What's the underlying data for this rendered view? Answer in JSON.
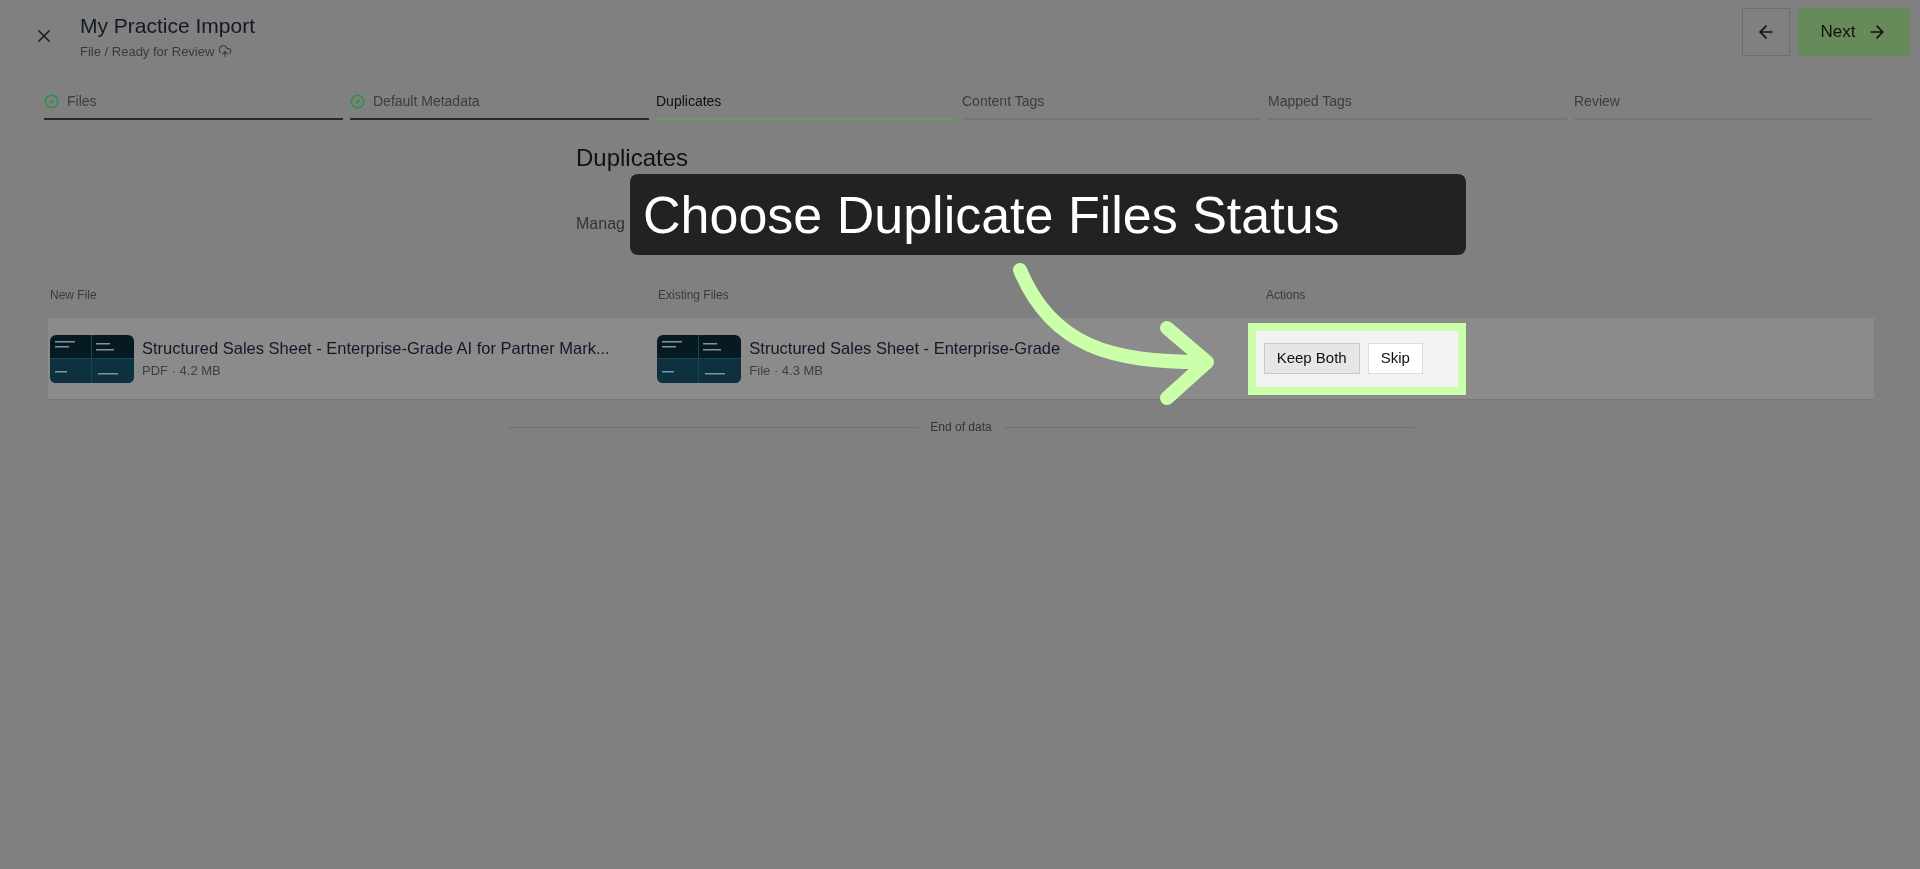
{
  "header": {
    "title": "My Practice Import",
    "breadcrumb": "File / Ready for Review",
    "next_label": "Next"
  },
  "steps": [
    {
      "label": "Files",
      "completed": true,
      "selected": false
    },
    {
      "label": "Default Metadata",
      "completed": true,
      "selected": false
    },
    {
      "label": "Duplicates",
      "completed": false,
      "selected": true
    },
    {
      "label": "Content Tags",
      "completed": false,
      "selected": false
    },
    {
      "label": "Mapped Tags",
      "completed": false,
      "selected": false
    },
    {
      "label": "Review",
      "completed": false,
      "selected": false
    }
  ],
  "section": {
    "title": "Duplicates",
    "subtitle": "Manag"
  },
  "table": {
    "columns": [
      "New File",
      "Existing Files",
      "Actions"
    ],
    "rows": [
      {
        "new_file": {
          "name": "Structured Sales Sheet - Enterprise-Grade AI for Partner Mark...",
          "meta": "PDF · 4.2 MB",
          "kind": "picture"
        },
        "existing_file": {
          "name": "Structured Sales Sheet - Enterprise-Grade",
          "meta": "File · 4.3 MB",
          "kind": "picture"
        },
        "actions": [
          {
            "label": "Keep Both",
            "selected": true
          },
          {
            "label": "Skip",
            "selected": false
          }
        ]
      }
    ],
    "footer": "End of data"
  },
  "callout": {
    "text": "Choose Duplicate Files Status"
  }
}
